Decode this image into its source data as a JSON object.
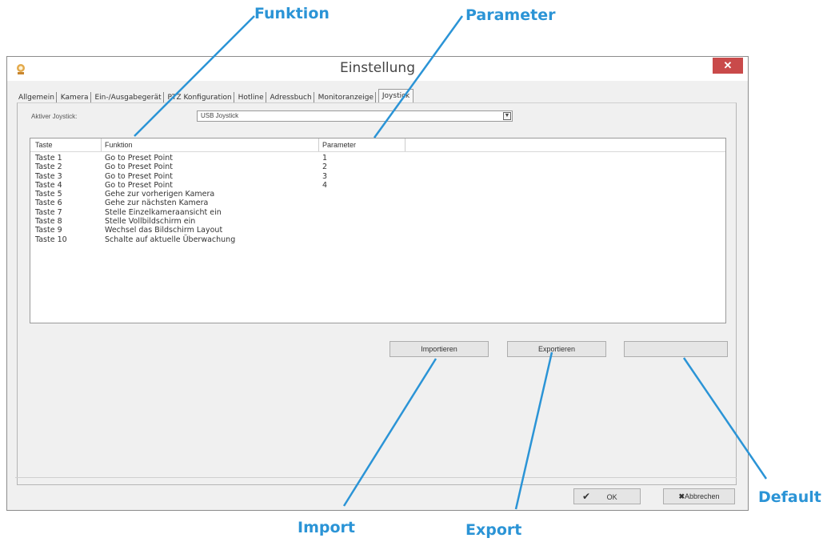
{
  "window": {
    "title": "Einstellung",
    "close_label": "✕",
    "tabs": [
      "Allgemein",
      "Kamera",
      "Ein-/Ausgabegerät",
      "PTZ Konfiguration",
      "Hotline",
      "Adressbuch",
      "Monitoranzeige",
      "Joystick"
    ],
    "active_tab": "Joystick"
  },
  "joystick": {
    "label": "Aktiver Joystick:",
    "selected": "USB Joystick"
  },
  "table": {
    "headers": [
      "Taste",
      "Funktion",
      "Parameter"
    ],
    "rows": [
      [
        "Taste 1",
        "Go to Preset Point",
        "1"
      ],
      [
        "Taste 2",
        "Go to Preset Point",
        "2"
      ],
      [
        "Taste 3",
        "Go to Preset Point",
        "3"
      ],
      [
        "Taste 4",
        "Go to Preset Point",
        "4"
      ],
      [
        "Taste 5",
        "Gehe zur vorherigen Kamera",
        ""
      ],
      [
        "Taste 6",
        "Gehe zur nächsten Kamera",
        ""
      ],
      [
        "Taste 7",
        "Stelle Einzelkameraansicht ein",
        ""
      ],
      [
        "Taste 8",
        "Stelle Vollbildschirm ein",
        ""
      ],
      [
        "Taste 9",
        "Wechsel das Bildschirm Layout",
        ""
      ],
      [
        "Taste 10",
        "Schalte auf aktuelle Überwachung",
        ""
      ]
    ]
  },
  "buttons": {
    "import": "Importieren",
    "export": "Exportieren",
    "default": "",
    "ok": "OK",
    "cancel": "Abbrechen"
  },
  "annotations": {
    "funktion": "Funktion",
    "parameter": "Parameter",
    "import": "Import",
    "export": "Export",
    "default": "Default"
  },
  "colors": {
    "annotation": "#2b94d6",
    "close": "#c94a4a"
  }
}
